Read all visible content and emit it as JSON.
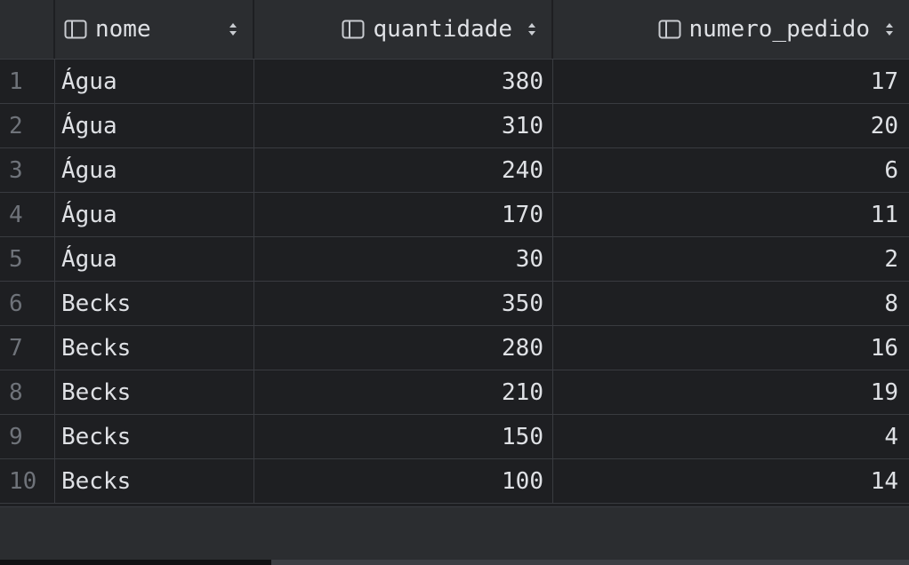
{
  "table": {
    "columns": [
      {
        "label": "nome",
        "icon": "column-icon",
        "sort_icon": "sort-icon"
      },
      {
        "label": "quantidade",
        "icon": "column-icon",
        "sort_icon": "sort-icon"
      },
      {
        "label": "numero_pedido",
        "icon": "column-icon",
        "sort_icon": "sort-icon"
      }
    ],
    "rows": [
      {
        "n": "1",
        "nome": "Água",
        "quantidade": "380",
        "numero_pedido": "17"
      },
      {
        "n": "2",
        "nome": "Água",
        "quantidade": "310",
        "numero_pedido": "20"
      },
      {
        "n": "3",
        "nome": "Água",
        "quantidade": "240",
        "numero_pedido": "6"
      },
      {
        "n": "4",
        "nome": "Água",
        "quantidade": "170",
        "numero_pedido": "11"
      },
      {
        "n": "5",
        "nome": "Água",
        "quantidade": "30",
        "numero_pedido": "2"
      },
      {
        "n": "6",
        "nome": "Becks",
        "quantidade": "350",
        "numero_pedido": "8"
      },
      {
        "n": "7",
        "nome": "Becks",
        "quantidade": "280",
        "numero_pedido": "16"
      },
      {
        "n": "8",
        "nome": "Becks",
        "quantidade": "210",
        "numero_pedido": "19"
      },
      {
        "n": "9",
        "nome": "Becks",
        "quantidade": "150",
        "numero_pedido": "4"
      },
      {
        "n": "10",
        "nome": "Becks",
        "quantidade": "100",
        "numero_pedido": "14"
      }
    ]
  },
  "colors": {
    "background": "#1e1f22",
    "header": "#2b2d30",
    "text": "#dfe1e5",
    "row_number": "#6f737a",
    "grid_line": "#393b40"
  }
}
